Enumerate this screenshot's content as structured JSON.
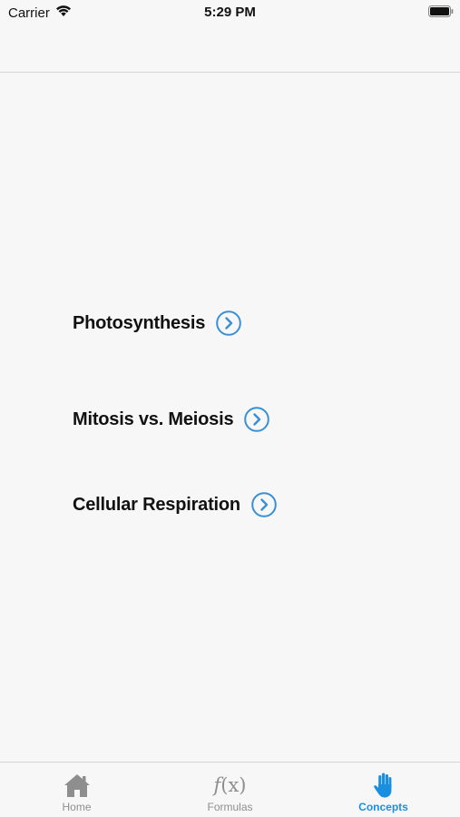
{
  "status_bar": {
    "carrier": "Carrier",
    "time": "5:29 PM"
  },
  "concepts": {
    "items": [
      {
        "label": "Photosynthesis"
      },
      {
        "label": "Mitosis vs. Meiosis"
      },
      {
        "label": "Cellular Respiration"
      }
    ]
  },
  "tab_bar": {
    "tabs": [
      {
        "label": "Home",
        "icon": "home-icon",
        "active": false
      },
      {
        "label": "Formulas",
        "icon": "function-icon",
        "icon_text_f": "f",
        "icon_text_x": "(x)",
        "active": false
      },
      {
        "label": "Concepts",
        "icon": "hand-icon",
        "active": true
      }
    ]
  },
  "colors": {
    "accent": "#1a8fe0",
    "chevron": "#3a8fd6",
    "inactive": "#8e8e8e",
    "background": "#f7f7f7"
  }
}
